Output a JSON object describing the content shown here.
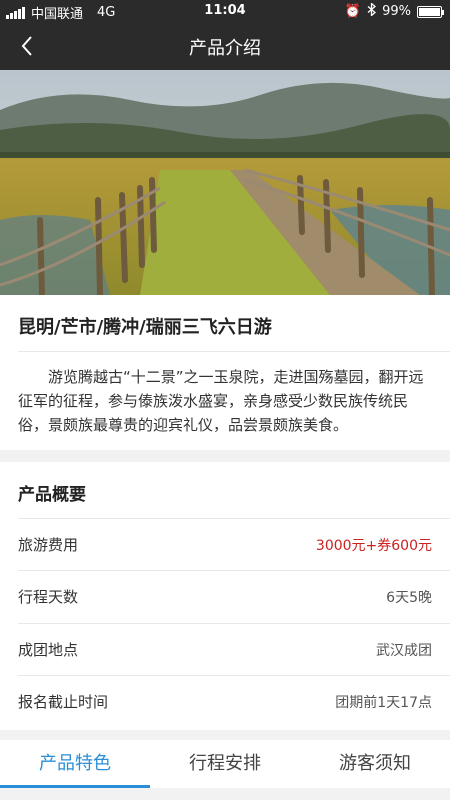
{
  "status_bar": {
    "carrier": "中国联通",
    "network": "4G",
    "time": "11:04",
    "battery": "99%",
    "battery_level": 0.99,
    "icons": [
      "signal-icon",
      "alarm-icon",
      "bluetooth-icon",
      "battery-icon"
    ]
  },
  "nav": {
    "title": "产品介绍",
    "back_icon": "back-arrow-icon"
  },
  "tour": {
    "title": "昆明/芒市/腾冲/瑞丽三飞六日游",
    "description": "游览腾越古“十二景”之一玉泉院，走进国殇墓园，翻开远征军的征程，参与傣族泼水盛宴，亲身感受少数民族传统民俗，景颇族最尊贵的迎宾礼仪，品尝景颇族美食。"
  },
  "overview": {
    "heading": "产品概要",
    "rows": [
      {
        "label": "旅游费用",
        "value": "3000元+券600元"
      },
      {
        "label": "行程天数",
        "value": "6天5晚"
      },
      {
        "label": "成团地点",
        "value": "武汉成团"
      },
      {
        "label": "报名截止时间",
        "value": "团期前1天17点"
      }
    ]
  },
  "tabs": [
    "产品特色",
    "行程安排",
    "游客须知"
  ],
  "colors": {
    "header_bg": "#2b2b2b",
    "accent": "#2a8fd8",
    "price": "#cc2222"
  }
}
